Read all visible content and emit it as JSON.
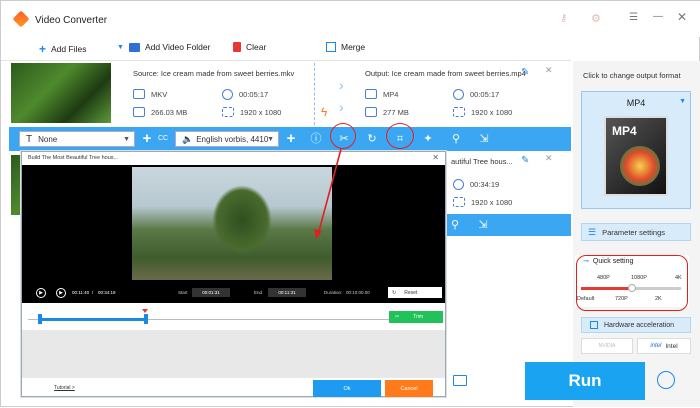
{
  "app": {
    "title": "Video Converter"
  },
  "toolbar": {
    "add_files": "Add Files",
    "add_folder": "Add Video Folder",
    "clear": "Clear",
    "merge": "Merge"
  },
  "row1": {
    "source": "Source: Ice cream made from sweet berries.mkv",
    "output": "Output: Ice cream made from sweet berries.mp4",
    "src_format": "MKV",
    "src_duration": "00:05:17",
    "src_size": "266.03 MB",
    "src_res": "1920 x 1080",
    "out_format": "MP4",
    "out_duration": "00:05:17",
    "out_size": "277 MB",
    "out_res": "1920 x 1080"
  },
  "row2": {
    "output": "autiful Tree hous...",
    "duration": "00:34:19",
    "res": "1920 x 1080"
  },
  "editbar": {
    "subtitle": "None",
    "audio": "English vorbis, 4410"
  },
  "right_panel": {
    "click_label": "Click to change output format",
    "format": "MP4",
    "format_icon": "MP4",
    "param_settings": "Parameter settings",
    "quick_setting": "Quick setting",
    "quality_top": [
      "480P",
      "1080P",
      "4K"
    ],
    "quality_bottom": [
      "Default",
      "720P",
      "2K"
    ],
    "quality_level": 0.5,
    "hw_accel": "Hardware acceleration",
    "nvidia": "NVIDIA",
    "intel": "Intel",
    "run": "Run"
  },
  "trim": {
    "title": "Build The Most Beautiful Tree hous...",
    "time_current": "00:11:40",
    "time_total": "00:34:19",
    "start_label": "Start",
    "start_value": "00:01:31",
    "end_label": "End",
    "end_value": "00:11:31",
    "duration_label": "Duration:",
    "duration_value": "00:10:00.00",
    "reset": "Reset",
    "trim_btn": "Trim",
    "tutorial": "Tutorial >",
    "ok": "Ok",
    "cancel": "Cancel"
  }
}
